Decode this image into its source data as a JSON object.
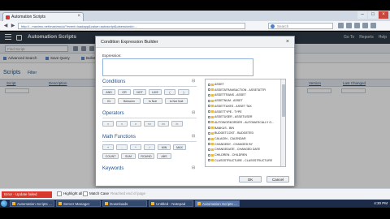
{
  "browser": {
    "tab_title": "Automation Scripts",
    "url": "http://...maximo.net/maximo/ui/?event=loadapp&value=autoscript&uisessionid=...",
    "search_placeholder": "Search"
  },
  "app": {
    "title": "Automation Scripts",
    "header_links": [
      "Go To",
      "Reports",
      "Help"
    ],
    "find_placeholder": "Find Script",
    "actions": [
      "Advanced Search",
      "Save Query",
      "Bulletins"
    ],
    "section_title": "Scripts",
    "filter_label": "Filter",
    "columns": [
      "Script",
      "Description",
      "Version",
      "Last Changed"
    ]
  },
  "dialog": {
    "title": "Condition Expression Builder",
    "expression_label": "Expression:",
    "expression_value": "",
    "sections": {
      "conditions": "Conditions",
      "operators": "Operators",
      "math": "Math Functions",
      "keywords": "Keywords"
    },
    "condition_buttons_row1": [
      "AND",
      "OR",
      "NOT",
      "LIKE",
      "(",
      ")"
    ],
    "condition_buttons_row2": [
      "IN",
      "Between",
      "Is Null",
      "Is Not Null"
    ],
    "operator_buttons": [
      "=",
      "<",
      ">",
      "<=",
      ">=",
      "!="
    ],
    "math_buttons_row1": [
      "+",
      "-",
      "*",
      "/",
      "MIN",
      "MAX"
    ],
    "math_buttons_row2": [
      "COUNT",
      "SUM",
      "ROUND",
      "ABS"
    ],
    "tree_items": [
      "ASSET",
      "ASSETATRANSACTION - ASSETATTR",
      "ASSETTRANS - ASSET",
      "ASSETNUM - ASSET",
      "ASSETTAXES - ASSET TAX",
      "ASSETTYPE - TYPE",
      "ASSETUSER - ASSETUSER",
      "AUTOWORKORDER - AUTOMATICALLY G...",
      "BANKUS - BIN",
      "BUDGETCOST - BUDGETED",
      "CALAGIN - CALENDAR",
      "CHANGEBY - CHANGED BY",
      "CHANGEDATE - CHANGED DATE",
      "CHILDREN - CHILDREN",
      "CLASSSTRUCTURE - CLASSSTRUCTURE"
    ],
    "ok_label": "OK",
    "cancel_label": "Cancel"
  },
  "footer": {
    "alert_text": "Error - Update failed",
    "highlight_label": "Highlight all",
    "match_case_label": "Match Case",
    "reached_text": "Reached end of page"
  },
  "taskbar": {
    "tasks": [
      "Automation Scripts ...",
      "Server Manager",
      "Downloads",
      "Untitled - Notepad",
      "Automation Scripts ..."
    ],
    "clock": "4:30 PM"
  }
}
